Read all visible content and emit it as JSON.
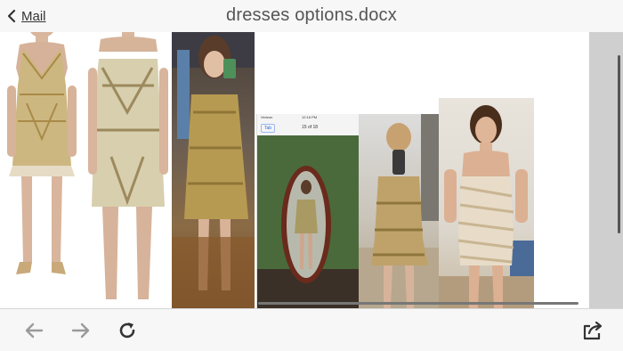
{
  "header": {
    "back_label": "Mail",
    "title": "dresses options.docx"
  },
  "phone_screenshot": {
    "carrier": "Verizon",
    "time": "12:16 PM",
    "tab_label": "Tab",
    "counter": "15 of 18"
  },
  "toolbar": {
    "icons": [
      "back-arrow-icon",
      "forward-arrow-icon",
      "reload-icon",
      "share-icon"
    ]
  },
  "colors": {
    "bar_bg": "#f7f7f7",
    "gutter": "#cfcfcf",
    "icon_gray": "#9a9a9a",
    "icon_dark": "#333333"
  }
}
